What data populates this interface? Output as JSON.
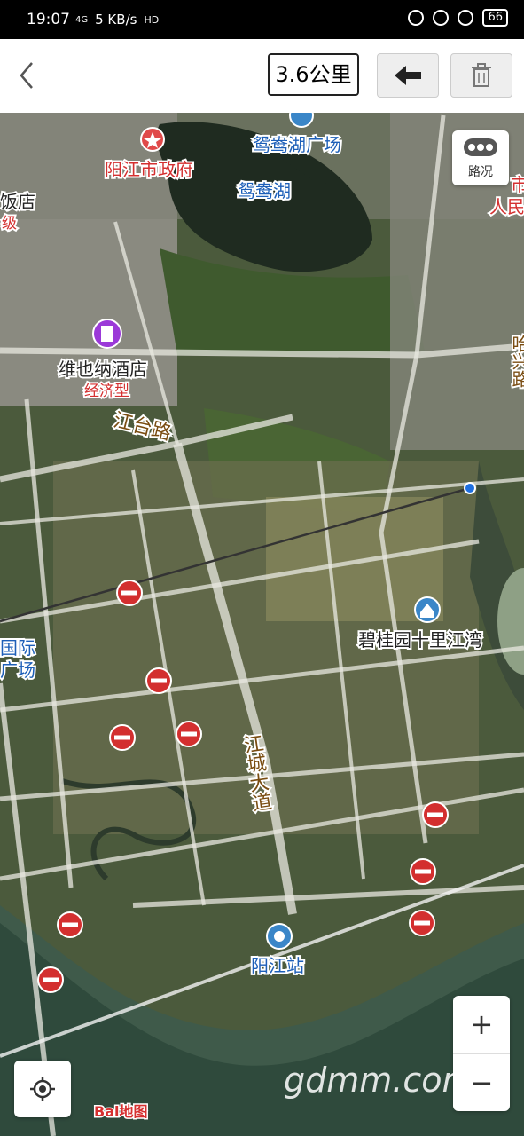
{
  "status": {
    "time": "19:07",
    "network": "5 KB/s",
    "signal": "4G",
    "hd": "HD",
    "battery": "66"
  },
  "toolbar": {
    "distance": "3.6公里",
    "undo_icon": "arrow-left-icon",
    "delete_icon": "trash-icon"
  },
  "traffic": {
    "label": "路况"
  },
  "labels": {
    "yanyang_park": "鸳鸯湖广场",
    "yanyang_lake": "鸳鸯湖",
    "gov": "阳江市政府",
    "hotel_left": "饭店",
    "level_left": "级",
    "hotel": "维也纳酒店",
    "hotel_type": "经济型",
    "road_jiangtai": "江台路",
    "road_jiangcheng": "江城大道",
    "biguiyuan": "碧桂园十里江湾",
    "guoji": "国际",
    "guangchang": "广场",
    "station": "阳江站",
    "right_top": "市",
    "right_people": "人民",
    "right_road": "哈兴路"
  },
  "baidu": {
    "logo": "Bai地图"
  },
  "watermark": "gdmm.com",
  "controls": {
    "zoom_in": "+",
    "zoom_out": "−"
  }
}
